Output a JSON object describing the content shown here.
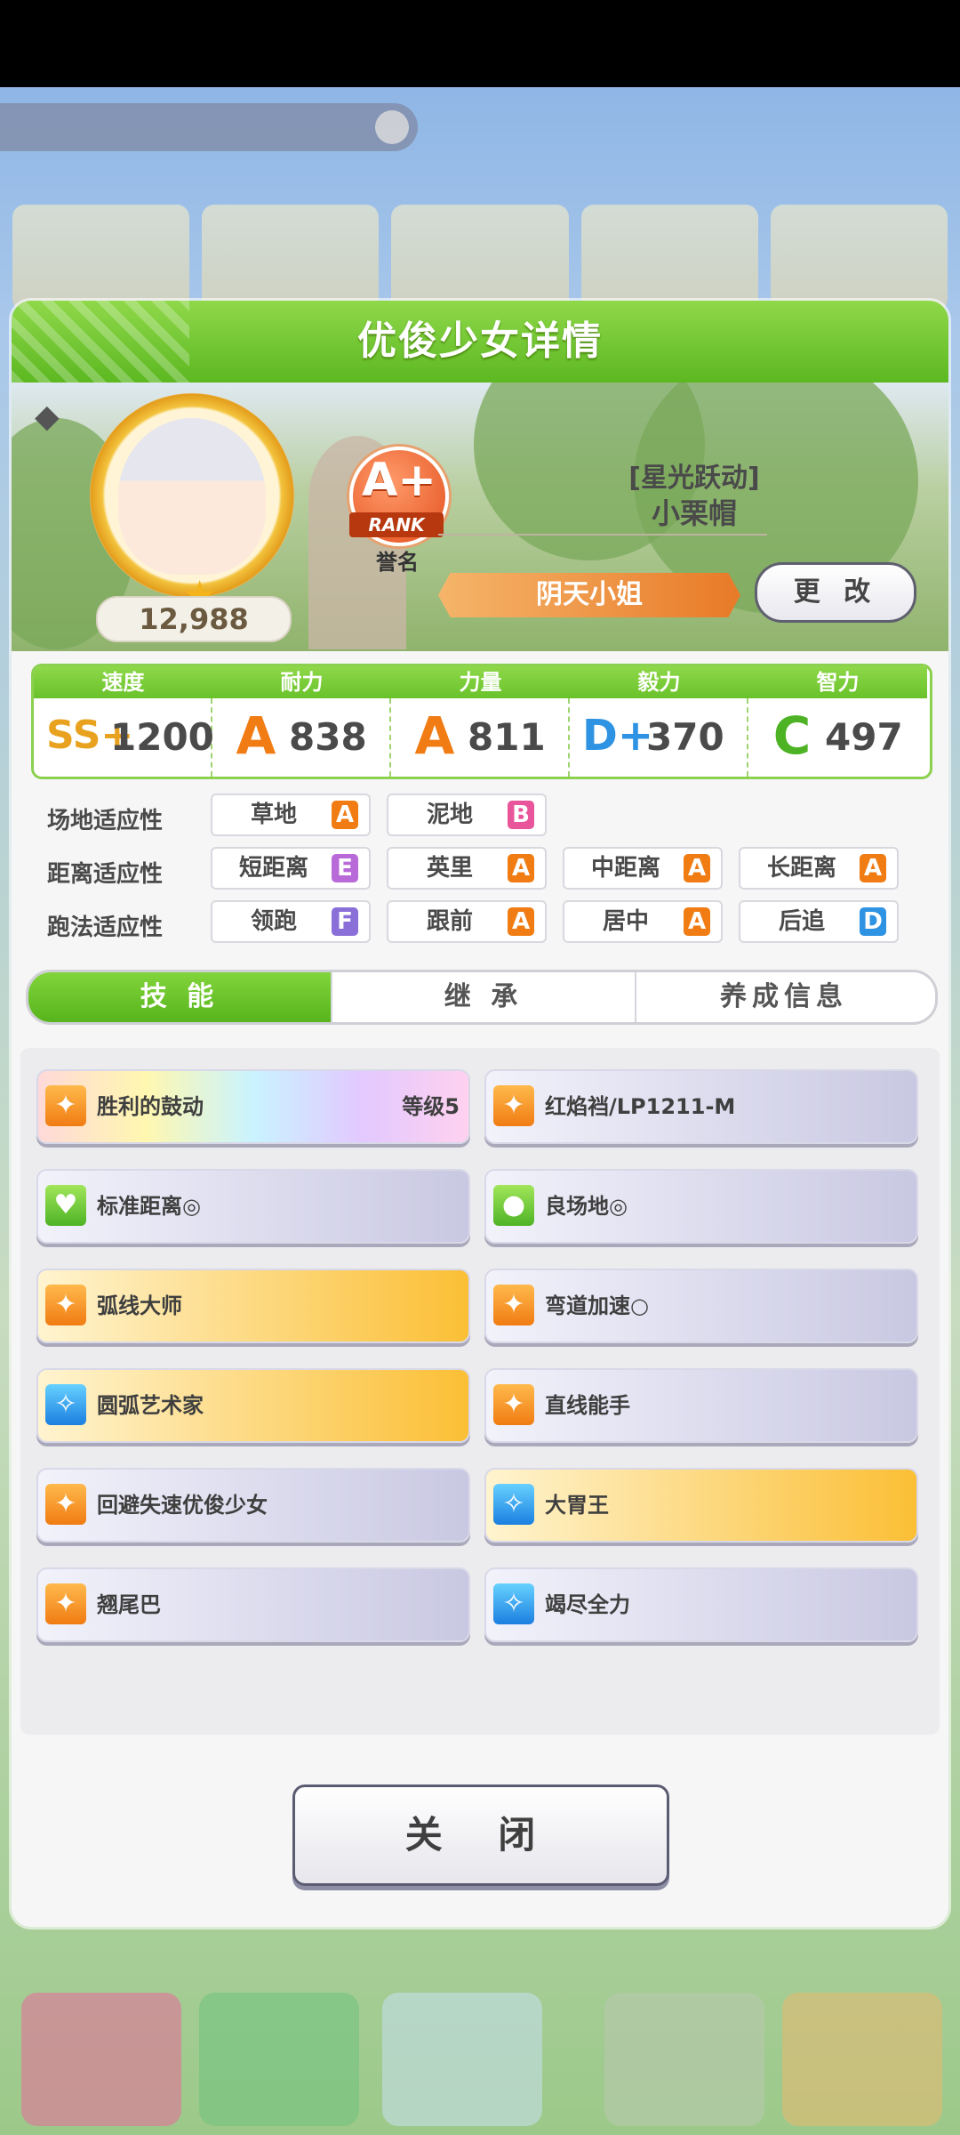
{
  "dialog": {
    "title": "优俊少女详情"
  },
  "profile": {
    "fans": "12,988",
    "rank_grade": "A+",
    "rank_tag": "RANK",
    "rank_label": "誉名",
    "horse_title": "[星光跃动]",
    "horse_name": "小栗帽",
    "nickname": "阴天小姐",
    "change_label": "更 改"
  },
  "stats": [
    {
      "label": "速度",
      "grade": "SS+",
      "value": "1200",
      "color": "#e8a21f"
    },
    {
      "label": "耐力",
      "grade": "A",
      "value": "838",
      "color": "#f07c13"
    },
    {
      "label": "力量",
      "grade": "A",
      "value": "811",
      "color": "#f07c13"
    },
    {
      "label": "毅力",
      "grade": "D+",
      "value": "370",
      "color": "#2f93e3"
    },
    {
      "label": "智力",
      "grade": "C",
      "value": "497",
      "color": "#4db325"
    }
  ],
  "aptitude": {
    "track": {
      "label": "场地适应性",
      "items": [
        {
          "name": "草地",
          "grade": "A"
        },
        {
          "name": "泥地",
          "grade": "B"
        }
      ]
    },
    "distance": {
      "label": "距离适应性",
      "items": [
        {
          "name": "短距离",
          "grade": "E"
        },
        {
          "name": "英里",
          "grade": "A"
        },
        {
          "name": "中距离",
          "grade": "A"
        },
        {
          "name": "长距离",
          "grade": "A"
        }
      ]
    },
    "style": {
      "label": "跑法适应性",
      "items": [
        {
          "name": "领跑",
          "grade": "F"
        },
        {
          "name": "跟前",
          "grade": "A"
        },
        {
          "name": "居中",
          "grade": "A"
        },
        {
          "name": "后追",
          "grade": "D"
        }
      ]
    }
  },
  "grade_colors": {
    "A": "#f07c13",
    "B": "#e9559a",
    "D": "#2f93e3",
    "E": "#b86ad8",
    "F": "#8a6fd8"
  },
  "tabs": [
    "技 能",
    "继 承",
    "养成信息"
  ],
  "skills": [
    {
      "name": "胜利的鼓动",
      "level": "等级5",
      "style": "rainbow",
      "icon": "orange"
    },
    {
      "name": "红焰裆/LP1211-M",
      "style": "plain",
      "icon": "orange"
    },
    {
      "name": "标准距离◎",
      "style": "plain",
      "icon": "green"
    },
    {
      "name": "良场地◎",
      "style": "plain",
      "icon": "green"
    },
    {
      "name": "弧线大师",
      "style": "gold",
      "icon": "orange"
    },
    {
      "name": "弯道加速○",
      "style": "plain",
      "icon": "orange"
    },
    {
      "name": "圆弧艺术家",
      "style": "gold",
      "icon": "blue"
    },
    {
      "name": "直线能手",
      "style": "plain",
      "icon": "orange"
    },
    {
      "name": "回避失速优俊少女",
      "style": "plain",
      "icon": "orange"
    },
    {
      "name": "大胃王",
      "style": "gold",
      "icon": "blue"
    },
    {
      "name": "翘尾巴",
      "style": "plain",
      "icon": "orange"
    },
    {
      "name": "竭尽全力",
      "style": "plain",
      "icon": "blue"
    }
  ],
  "close_label": "关 闭"
}
